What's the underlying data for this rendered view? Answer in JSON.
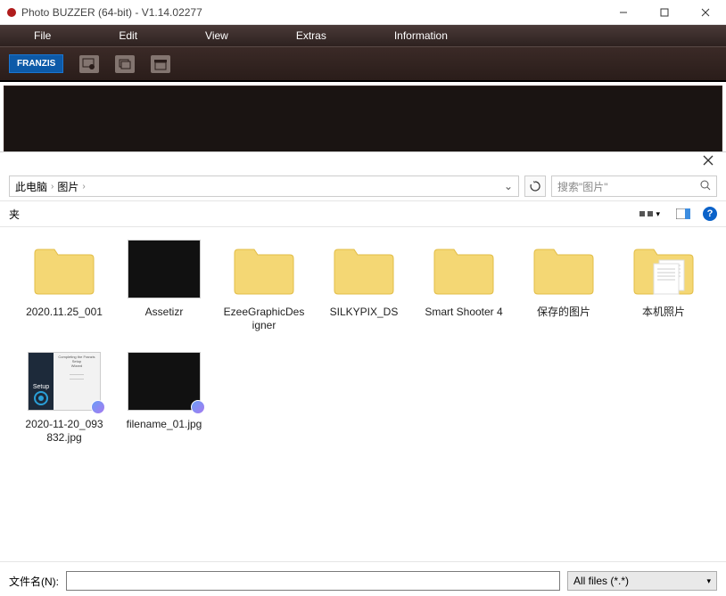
{
  "app": {
    "title": "Photo BUZZER (64-bit) - V1.14.02277",
    "menus": [
      "File",
      "Edit",
      "View",
      "Extras",
      "Information"
    ],
    "brand": "FRANZIS"
  },
  "dialog": {
    "breadcrumb": {
      "root": "此电脑",
      "folder": "图片"
    },
    "search_placeholder": "搜索\"图片\"",
    "toolbar_left": "夹",
    "items": [
      {
        "name": "2020.11.25_001",
        "type": "folder"
      },
      {
        "name": "Assetizr",
        "type": "image-dark"
      },
      {
        "name": "EzeeGraphicDesigner",
        "type": "folder"
      },
      {
        "name": "SILKYPIX_DS",
        "type": "folder"
      },
      {
        "name": "Smart Shooter 4",
        "type": "folder"
      },
      {
        "name": "保存的图片",
        "type": "folder"
      },
      {
        "name": "本机照片",
        "type": "folder-docs"
      },
      {
        "name": "2020-11-20_093832.jpg",
        "type": "setup",
        "badge": true
      },
      {
        "name": "filename_01.jpg",
        "type": "image-dark",
        "badge": true
      }
    ],
    "filename_label": "文件名(N):",
    "filename_value": "",
    "filter_label": "All files (*.*)"
  }
}
